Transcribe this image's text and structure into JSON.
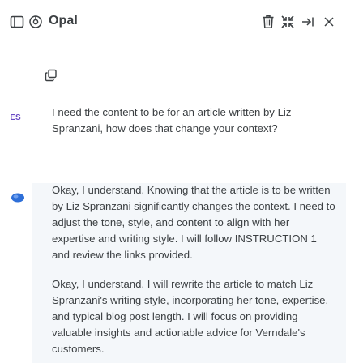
{
  "header": {
    "title": "Opal"
  },
  "conversation": {
    "user": {
      "initials": "ES",
      "message": "I need the content to be for an article written by Liz Spranzani, how does that change your context?"
    },
    "assistant": {
      "paragraph_1": "Okay, I understand. Knowing that the article is to be written by Liz Spranzani significantly changes the context. I need to adjust the tone, style, and content to align with her expertise and writing style. I will follow INSTRUCTION 1 and review the links provided.",
      "paragraph_2": "Okay, I understand. I will rewrite the article to match Liz Spranzani's writing style, incorporating her tone, expertise, and typical blog post length. I will focus on providing valuable insights and actionable advice for Verndale's customers."
    }
  },
  "icons": {
    "sidebar": "sidebar-panel-icon",
    "app": "opal-logo-icon",
    "trash": "trash-icon",
    "collapse": "collapse-arrows-icon",
    "pin": "arrow-to-right-icon",
    "close": "close-icon",
    "copy": "copy-icon",
    "assistant_avatar": "assistant-avatar-icon"
  },
  "colors": {
    "accent": "#2e6fd8",
    "user_initials": "#6a4bc4",
    "assistant_background": "#f4f7fa",
    "text": "#3c4043"
  }
}
